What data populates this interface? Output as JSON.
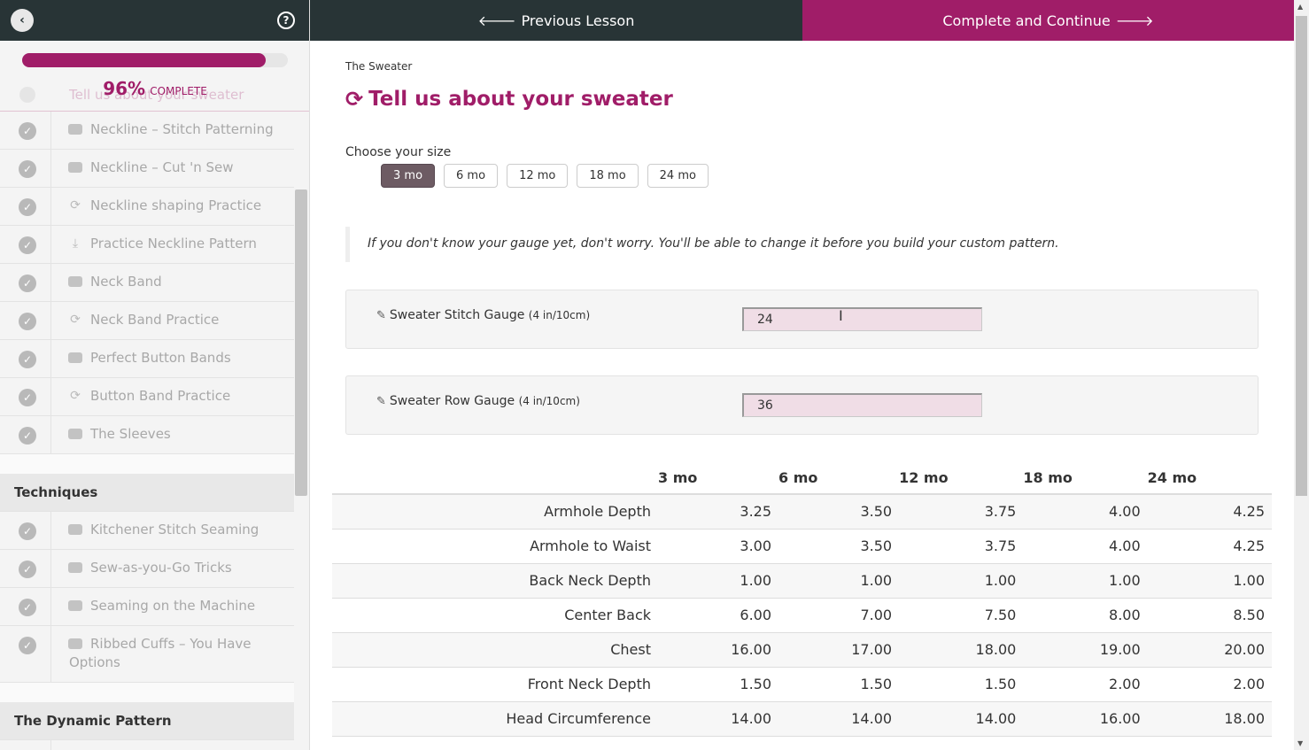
{
  "sidebar": {
    "progress_percent": "96%",
    "progress_label": "COMPLETE",
    "progress_fraction": 0.96,
    "ghost_item": "Tell us about your sweater",
    "lessons_a": [
      {
        "type": "video",
        "label": "Neckline – Stitch Patterning"
      },
      {
        "type": "video",
        "label": "Neckline – Cut 'n Sew"
      },
      {
        "type": "quiz",
        "label": "Neckline shaping Practice"
      },
      {
        "type": "download",
        "label": "Practice Neckline Pattern"
      },
      {
        "type": "video",
        "label": "Neck Band"
      },
      {
        "type": "quiz",
        "label": "Neck Band Practice"
      },
      {
        "type": "video",
        "label": "Perfect Button Bands"
      },
      {
        "type": "quiz",
        "label": "Button Band Practice"
      },
      {
        "type": "video",
        "label": "The Sleeves"
      }
    ],
    "section_techniques": "Techniques",
    "lessons_b": [
      {
        "type": "video",
        "label": "Kitchener Stitch Seaming"
      },
      {
        "type": "video",
        "label": "Sew-as-you-Go Tricks"
      },
      {
        "type": "video",
        "label": "Seaming on the Machine"
      },
      {
        "type": "video",
        "label": "Ribbed Cuffs – You Have Options"
      }
    ],
    "section_dynamic": "The Dynamic Pattern"
  },
  "nav": {
    "prev_label": "Previous Lesson",
    "next_label": "Complete and Continue"
  },
  "main": {
    "breadcrumb": "The Sweater",
    "title": "Tell us about your sweater",
    "size_label": "Choose your size",
    "sizes": [
      "3 mo",
      "6 mo",
      "12 mo",
      "18 mo",
      "24 mo"
    ],
    "selected_size": "3 mo",
    "note": "If you don't know your gauge yet, don't worry. You'll be able to change it before you build your custom pattern.",
    "stitch_gauge_label": "Sweater Stitch Gauge",
    "stitch_gauge_unit": "(4 in/10cm)",
    "stitch_gauge_value": "24",
    "row_gauge_label": "Sweater Row Gauge",
    "row_gauge_unit": "(4 in/10cm)",
    "row_gauge_value": "36"
  },
  "table": {
    "headers": [
      "3 mo",
      "6 mo",
      "12 mo",
      "18 mo",
      "24 mo"
    ],
    "rows": [
      {
        "label": "Armhole Depth",
        "values": [
          "3.25",
          "3.50",
          "3.75",
          "4.00",
          "4.25"
        ]
      },
      {
        "label": "Armhole to Waist",
        "values": [
          "3.00",
          "3.50",
          "3.75",
          "4.00",
          "4.25"
        ]
      },
      {
        "label": "Back Neck Depth",
        "values": [
          "1.00",
          "1.00",
          "1.00",
          "1.00",
          "1.00"
        ]
      },
      {
        "label": "Center Back",
        "values": [
          "6.00",
          "7.00",
          "7.50",
          "8.00",
          "8.50"
        ]
      },
      {
        "label": "Chest",
        "values": [
          "16.00",
          "17.00",
          "18.00",
          "19.00",
          "20.00"
        ]
      },
      {
        "label": "Front Neck Depth",
        "values": [
          "1.50",
          "1.50",
          "1.50",
          "2.00",
          "2.00"
        ]
      },
      {
        "label": "Head Circumference",
        "values": [
          "14.00",
          "14.00",
          "14.00",
          "16.00",
          "18.00"
        ]
      }
    ]
  },
  "colors": {
    "accent": "#a01d68",
    "dark": "#283436",
    "selected_size_bg": "#6d5b63"
  }
}
